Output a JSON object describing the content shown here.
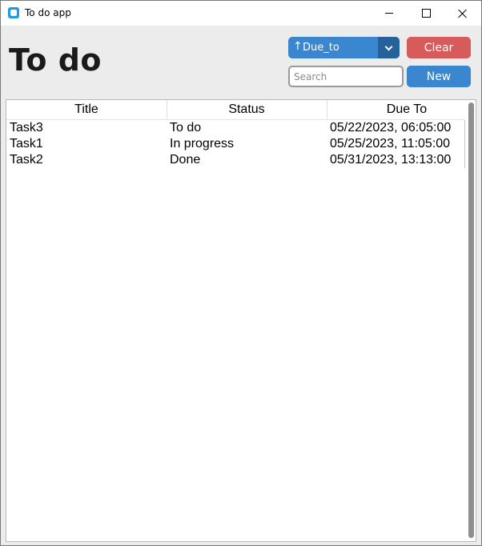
{
  "window": {
    "title": "To do app"
  },
  "header": {
    "heading": "To do"
  },
  "toolbar": {
    "sort_arrow": "↑",
    "sort_value": "Due_to",
    "clear_label": "Clear",
    "new_label": "New",
    "search_placeholder": "Search",
    "search_value": ""
  },
  "table": {
    "columns": [
      "Title",
      "Status",
      "Due To"
    ],
    "rows": [
      {
        "title": "Task3",
        "status": "To do",
        "due": "05/22/2023, 06:05:00"
      },
      {
        "title": "Task1",
        "status": "In progress",
        "due": "05/25/2023, 11:05:00"
      },
      {
        "title": "Task2",
        "status": "Done",
        "due": "05/31/2023, 13:13:00"
      }
    ]
  },
  "colors": {
    "primary": "#3a87cf",
    "primary_dark": "#25629b",
    "danger": "#d75b5b",
    "app_icon": "#1f9be0",
    "background": "#ececec"
  }
}
